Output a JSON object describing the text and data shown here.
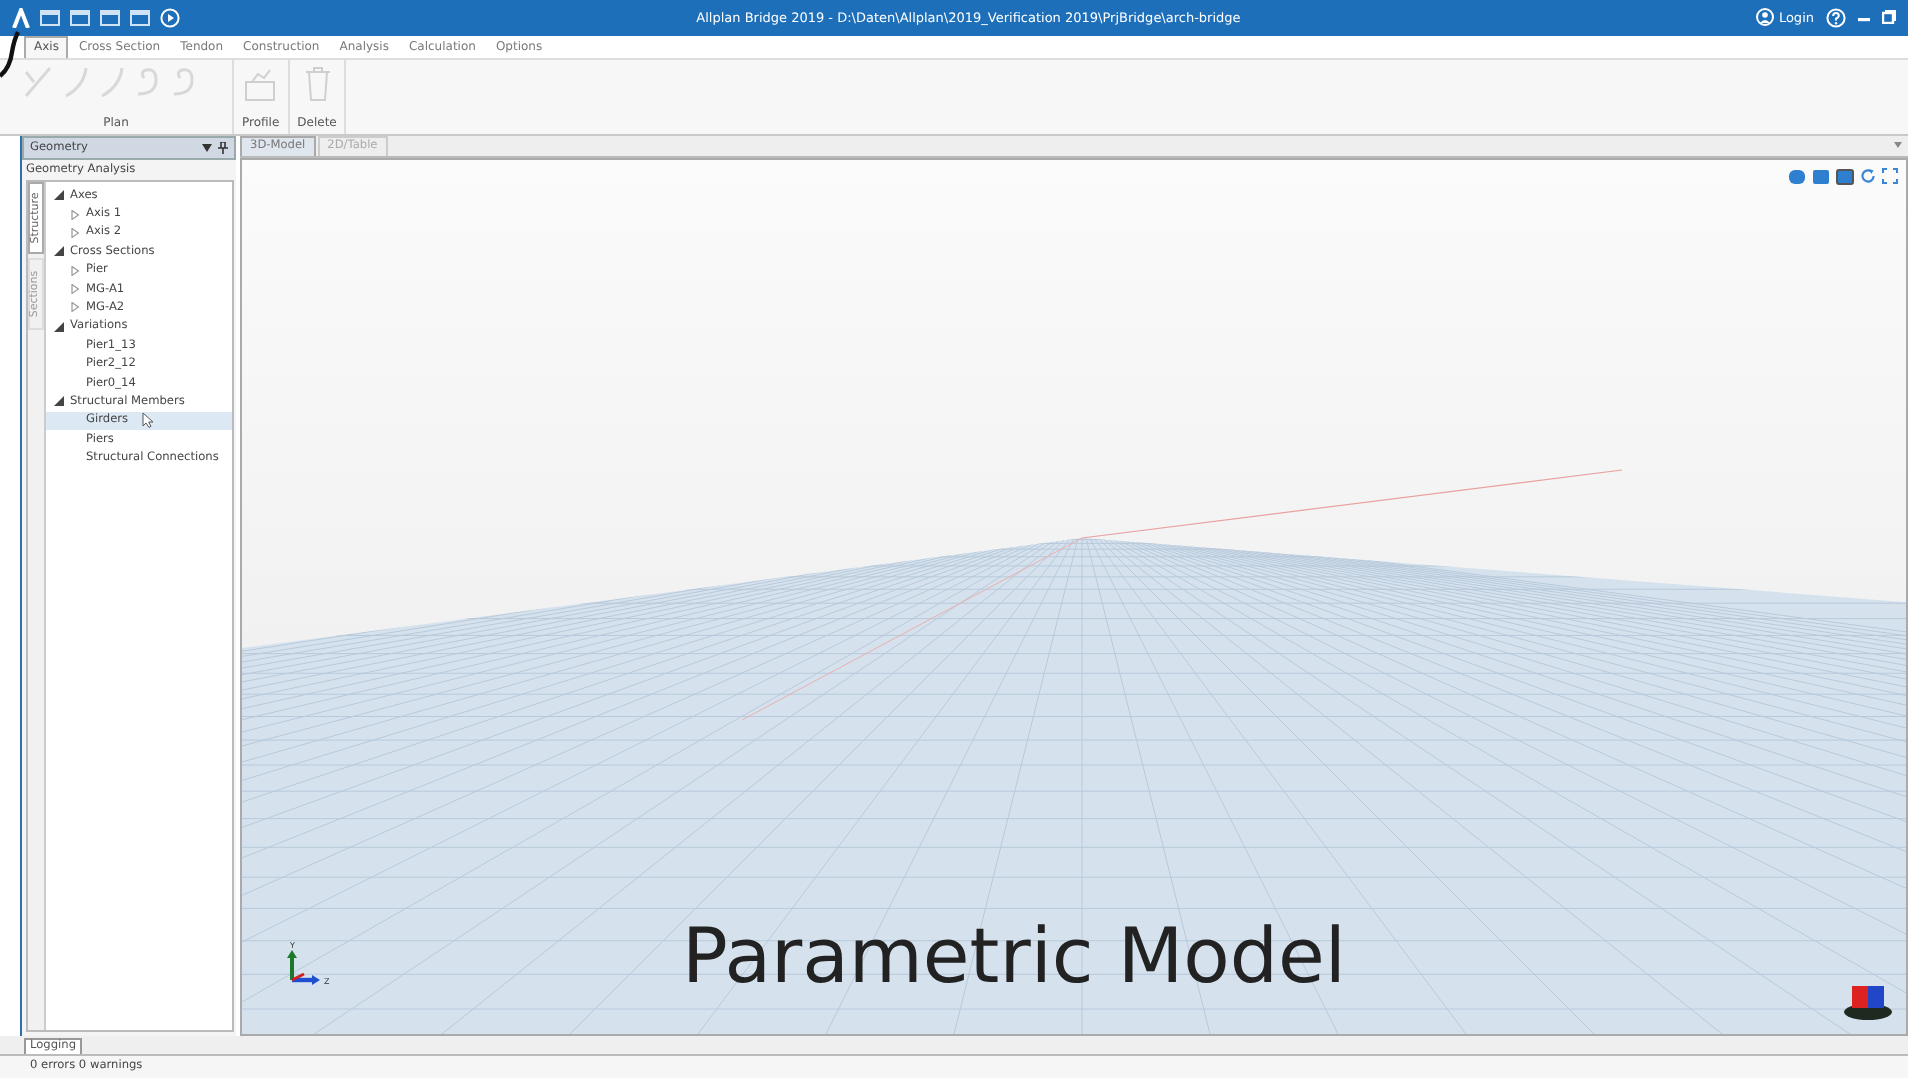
{
  "title_bar": {
    "title": "Allplan Bridge 2019 - D:\\Daten\\Allplan\\2019_Verification 2019\\PrjBridge\\arch-bridge",
    "login": "Login"
  },
  "ribbon_tabs": [
    {
      "label": "Axis",
      "selected": true
    },
    {
      "label": "Cross Section",
      "selected": false
    },
    {
      "label": "Tendon",
      "selected": false
    },
    {
      "label": "Construction",
      "selected": false
    },
    {
      "label": "Analysis",
      "selected": false
    },
    {
      "label": "Calculation",
      "selected": false
    },
    {
      "label": "Options",
      "selected": false
    }
  ],
  "ribbon_groups": [
    {
      "label": "Plan",
      "kind": "plan"
    },
    {
      "label": "Profile",
      "kind": "profile"
    },
    {
      "label": "Delete",
      "kind": "delete"
    }
  ],
  "panel": {
    "title": "Geometry",
    "subtitle": "Geometry Analysis",
    "side_tabs": [
      {
        "label": "Structure",
        "selected": true
      },
      {
        "label": "Sections",
        "selected": false
      }
    ],
    "tree": [
      {
        "label": "Axes",
        "expanded": true,
        "selected": false,
        "children": [
          {
            "label": "Axis 1",
            "expanded": false,
            "selected": false
          },
          {
            "label": "Axis 2",
            "expanded": false,
            "selected": false
          }
        ]
      },
      {
        "label": "Cross Sections",
        "expanded": true,
        "selected": false,
        "children": [
          {
            "label": "Pier",
            "expanded": false,
            "selected": false
          },
          {
            "label": "MG-A1",
            "expanded": false,
            "selected": false
          },
          {
            "label": "MG-A2",
            "expanded": false,
            "selected": false
          }
        ]
      },
      {
        "label": "Variations",
        "expanded": true,
        "selected": false,
        "children": [
          {
            "label": "Pier1_13",
            "selected": false
          },
          {
            "label": "Pier2_12",
            "selected": false
          },
          {
            "label": "Pier0_14",
            "selected": false
          }
        ]
      },
      {
        "label": "Structural Members",
        "expanded": true,
        "selected": false,
        "children": [
          {
            "label": "Girders",
            "selected": true
          },
          {
            "label": "Piers",
            "selected": false
          },
          {
            "label": "Structural Connections",
            "selected": false
          }
        ]
      }
    ]
  },
  "view_tabs": [
    {
      "label": "3D-Model",
      "selected": true
    },
    {
      "label": "2D/Table",
      "selected": false
    }
  ],
  "caption": "Parametric Model",
  "axis_labels": {
    "y": "Y",
    "z": "Z"
  },
  "bottom_tabs": [
    {
      "label": "Logging",
      "selected": true
    }
  ],
  "status_bar": "0 errors 0 warnings"
}
